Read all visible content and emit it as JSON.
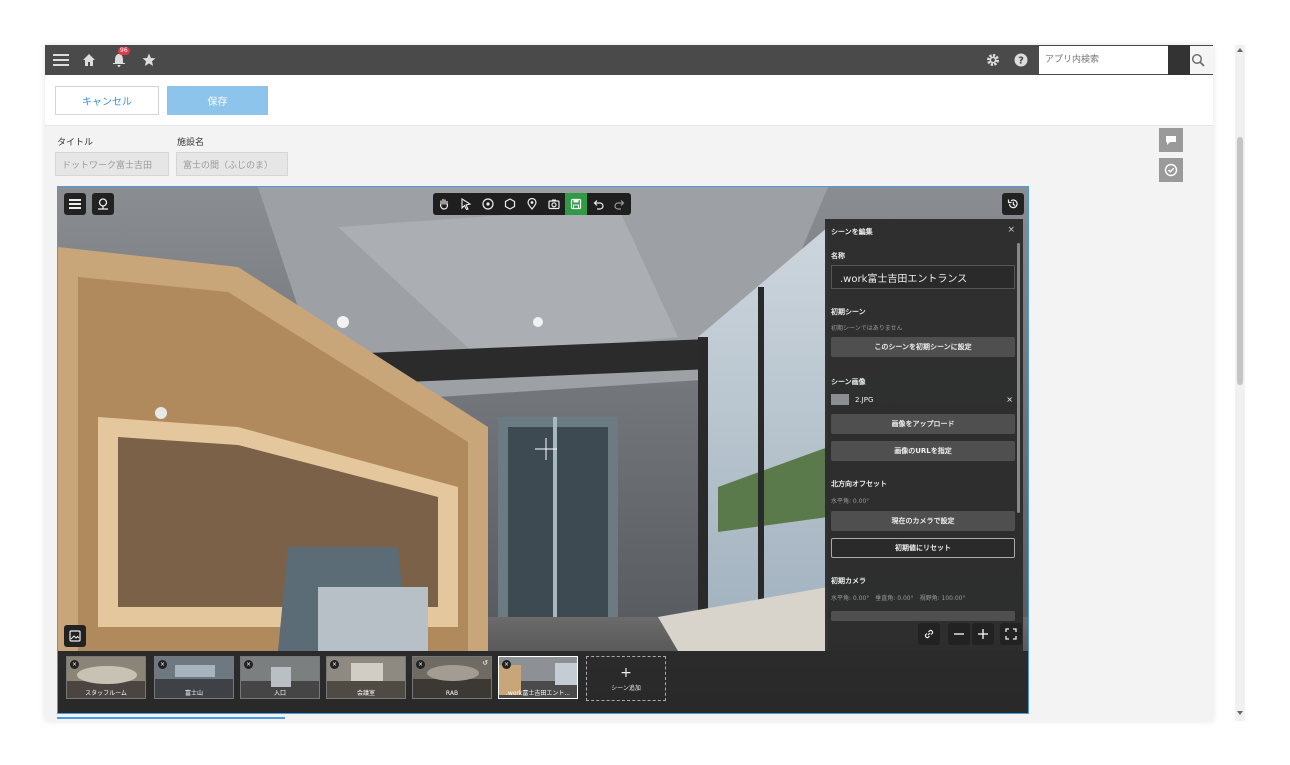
{
  "nav": {
    "notification_count": "96",
    "search_placeholder": "アプリ内検索"
  },
  "toolbar": {
    "cancel_label": "キャンセル",
    "save_label": "保存"
  },
  "form": {
    "title_label": "タイトル",
    "title_value": "ドットワーク富士吉田",
    "facility_label": "施設名",
    "facility_value": "富士の間（ふじのま）"
  },
  "panel": {
    "header": "シーンを編集",
    "close": "×",
    "name_label": "名称",
    "name_value": ".work富士吉田エントランス",
    "initial_scene_label": "初期シーン",
    "initial_scene_status": "初期シーンではありません",
    "set_initial_button": "このシーンを初期シーンに設定",
    "scene_image_label": "シーン画像",
    "image_file": "2.JPG",
    "image_remove": "×",
    "upload_button": "画像をアップロード",
    "url_button": "画像のURLを指定",
    "north_offset_label": "北方向オフセット",
    "north_offset_value": "水平角: 0.00°",
    "set_camera_button": "現在のカメラで設定",
    "reset_button": "初期値にリセット",
    "initial_camera_label": "初期カメラ",
    "initial_camera_value": "水平角: 0.00°　垂直角: 0.00°　視野角: 100.00°"
  },
  "scenes": [
    {
      "label": "スタッフルーム"
    },
    {
      "label": "富士山"
    },
    {
      "label": "入口"
    },
    {
      "label": "会議室"
    },
    {
      "label": "RAB"
    },
    {
      "label": ".work富士吉田エント..."
    }
  ],
  "add_scene": {
    "plus": "+",
    "label": "シーン追加"
  }
}
